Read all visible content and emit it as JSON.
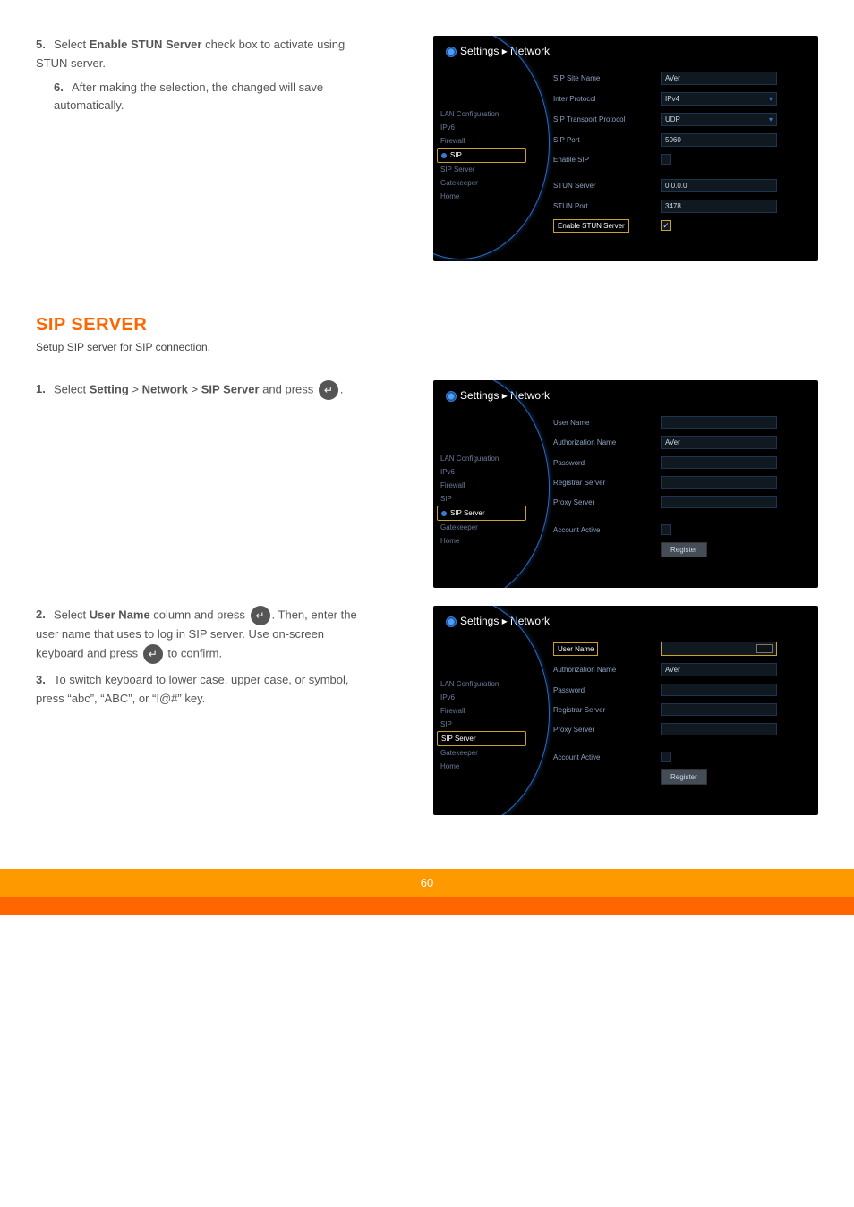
{
  "strings": {
    "settings_network": "Settings ▸ Network"
  },
  "sidebar_items": [
    "LAN Configuration",
    "IPv6",
    "Firewall",
    "SIP",
    "SIP Server",
    "Gatekeeper",
    "Home"
  ],
  "shot1": {
    "sip_site_name_l": "SIP Site Name",
    "sip_site_name_v": "AVer",
    "inter_protocol_l": "Inter Protocol",
    "inter_protocol_v": "IPv4",
    "sip_transport_l": "SIP Transport Protocol",
    "sip_transport_v": "UDP",
    "sip_port_l": "SIP Port",
    "sip_port_v": "5060",
    "enable_sip_l": "Enable SIP",
    "stun_server_l": "STUN Server",
    "stun_server_v": "0.0.0.0",
    "stun_port_l": "STUN Port",
    "stun_port_v": "3478",
    "enable_stun_l": "Enable STUN Server"
  },
  "shot2": {
    "user_name_l": "User Name",
    "user_name_v": "",
    "auth_name_l": "Authorization Name",
    "auth_name_v": "AVer",
    "password_l": "Password",
    "password_v": "",
    "registrar_l": "Registrar Server",
    "registrar_v": "",
    "proxy_l": "Proxy Server",
    "proxy_v": "",
    "account_active_l": "Account Active",
    "register_btn": "Register"
  },
  "shot3": {
    "user_name_l": "User Name",
    "user_name_v": "",
    "auth_name_l": "Authorization Name",
    "auth_name_v": "AVer",
    "password_l": "Password",
    "password_v": "",
    "registrar_l": "Registrar Server",
    "registrar_v": "",
    "proxy_l": "Proxy Server",
    "proxy_v": "",
    "account_active_l": "Account Active",
    "register_btn": "Register"
  },
  "steps": {
    "s5a": "Select ",
    "s5b": "Enable STUN Server",
    "s5c": " check box to activate using STUN server.",
    "s6": "After making the selection, the changed will save automatically.",
    "sec_heading": "SIP SERVER",
    "sec_sub": "Setup SIP server for SIP connection.",
    "s1a": "Select ",
    "s1b": "Setting",
    "s1c": "Network",
    "s1d": "SIP Server",
    "s1e": " and press ",
    "s2a": "Select ",
    "s2b": "User Name",
    "s2c": " column and press ",
    "s2d": ". Then, enter the user name that uses to log in SIP server. Use on-screen keyboard and press ",
    "s2e": " to confirm.",
    "s3": "To switch keyboard to lower case, upper case, or symbol, press “abc”, “ABC”, or “!@#” key."
  },
  "page_number": "60"
}
